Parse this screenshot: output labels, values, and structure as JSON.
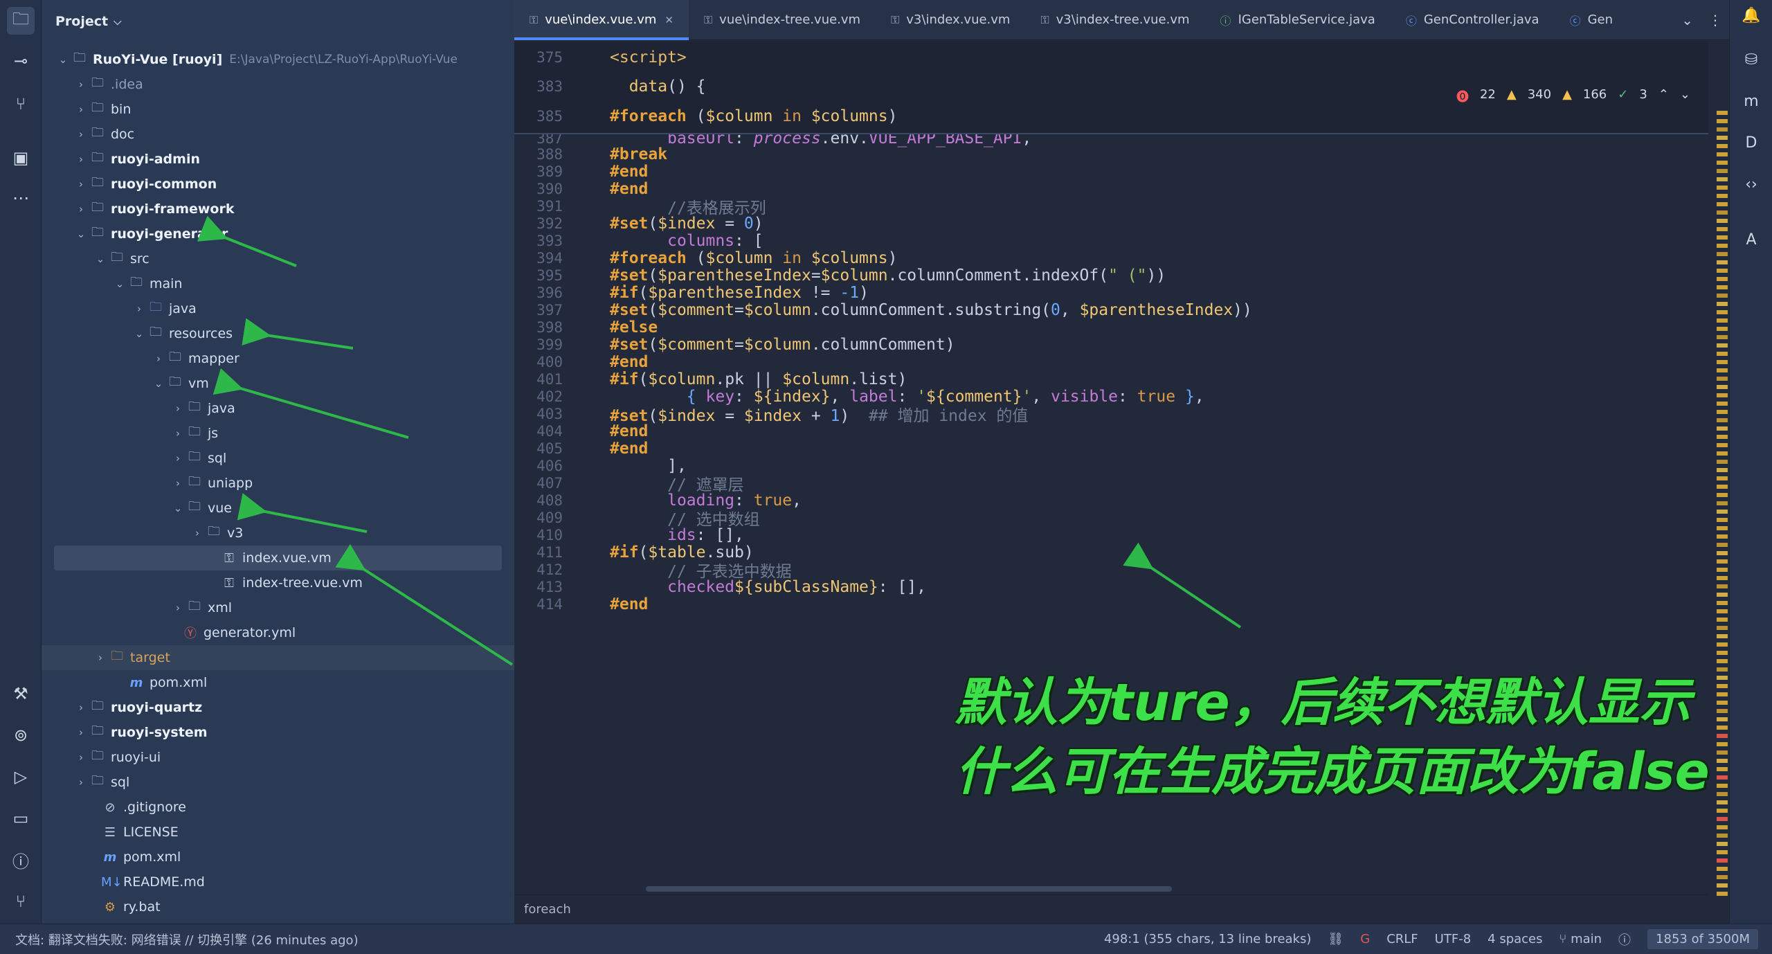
{
  "project": {
    "title": "Project",
    "root_name": "RuoYi-Vue [ruoyi]",
    "root_path": "E:\\Java\\Project\\LZ-RuoYi-App\\RuoYi-Vue",
    "items": [
      {
        "label": ".idea",
        "dim": true
      },
      {
        "label": "bin"
      },
      {
        "label": "doc"
      },
      {
        "label": "ruoyi-admin",
        "bold": true
      },
      {
        "label": "ruoyi-common",
        "bold": true
      },
      {
        "label": "ruoyi-framework",
        "bold": true
      },
      {
        "label": "ruoyi-generator",
        "bold": true
      },
      {
        "label": "src"
      },
      {
        "label": "main"
      },
      {
        "label": "java"
      },
      {
        "label": "resources"
      },
      {
        "label": "mapper"
      },
      {
        "label": "vm"
      },
      {
        "label": "java"
      },
      {
        "label": "js"
      },
      {
        "label": "sql"
      },
      {
        "label": "uniapp"
      },
      {
        "label": "vue"
      },
      {
        "label": "v3"
      },
      {
        "label": "index.vue.vm"
      },
      {
        "label": "index-tree.vue.vm"
      },
      {
        "label": "xml"
      },
      {
        "label": "generator.yml"
      },
      {
        "label": "target"
      },
      {
        "label": "pom.xml"
      },
      {
        "label": "ruoyi-quartz",
        "bold": true
      },
      {
        "label": "ruoyi-system",
        "bold": true
      },
      {
        "label": "ruoyi-ui"
      },
      {
        "label": "sql"
      },
      {
        "label": ".gitignore"
      },
      {
        "label": "LICENSE"
      },
      {
        "label": "pom.xml"
      },
      {
        "label": "README.md"
      },
      {
        "label": "ry.bat"
      }
    ]
  },
  "tabs": [
    {
      "label": "vue\\index.vue.vm",
      "active": true
    },
    {
      "label": "vue\\index-tree.vue.vm"
    },
    {
      "label": "v3\\index.vue.vm"
    },
    {
      "label": "v3\\index-tree.vue.vm"
    },
    {
      "label": "IGenTableService.java"
    },
    {
      "label": "GenController.java"
    },
    {
      "label": "Gen"
    }
  ],
  "inspections": {
    "errors": "22",
    "warnings": "340",
    "weak_warnings": "166",
    "typos": "3"
  },
  "code": {
    "sticky": [
      {
        "ln": "375"
      },
      {
        "ln": "383"
      },
      {
        "ln": "385"
      }
    ],
    "lines": [
      {
        "ln": "387"
      },
      {
        "ln": "388"
      },
      {
        "ln": "389"
      },
      {
        "ln": "390"
      },
      {
        "ln": "391"
      },
      {
        "ln": "392"
      },
      {
        "ln": "393"
      },
      {
        "ln": "394"
      },
      {
        "ln": "395"
      },
      {
        "ln": "396"
      },
      {
        "ln": "397"
      },
      {
        "ln": "398"
      },
      {
        "ln": "399"
      },
      {
        "ln": "400"
      },
      {
        "ln": "401"
      },
      {
        "ln": "402"
      },
      {
        "ln": "403"
      },
      {
        "ln": "404"
      },
      {
        "ln": "405"
      },
      {
        "ln": "406"
      },
      {
        "ln": "407"
      },
      {
        "ln": "408"
      },
      {
        "ln": "409"
      },
      {
        "ln": "410"
      },
      {
        "ln": "411"
      },
      {
        "ln": "412"
      },
      {
        "ln": "413"
      },
      {
        "ln": "414"
      }
    ]
  },
  "breadcrumb": "foreach",
  "overlay": {
    "line1": "默认为ture，后续不想默认显示",
    "line2": "什么可在生成完成页面改为false"
  },
  "status": {
    "message": "文档: 翻译文档失败: 网络错误 // 切换引擎 (26 minutes ago)",
    "position": "498:1 (355 chars, 13 line breaks)",
    "line_sep": "CRLF",
    "encoding": "UTF-8",
    "indent": "4 spaces",
    "branch": "main",
    "memory": "1853 of 3500M"
  },
  "colors": {
    "accent": "#4d8cff",
    "overlay_text": "#3ee04a",
    "arrow": "#2eb84a"
  }
}
